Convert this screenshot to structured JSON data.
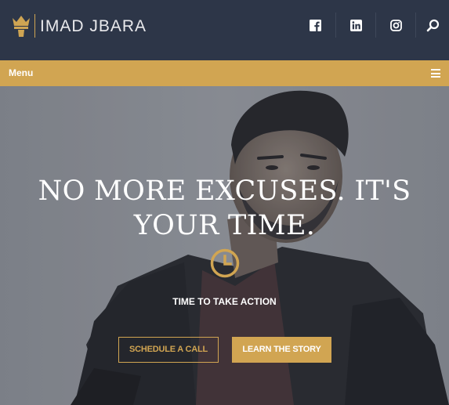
{
  "header": {
    "brand": "IMAD JBARA",
    "social": [
      {
        "name": "facebook",
        "icon": "facebook-icon"
      },
      {
        "name": "linkedin",
        "icon": "linkedin-icon"
      },
      {
        "name": "instagram",
        "icon": "instagram-icon"
      }
    ],
    "search_icon": "search-icon"
  },
  "menu": {
    "label": "Menu",
    "icon": "hamburger-icon"
  },
  "hero": {
    "headline": "NO MORE EXCUSES. IT'S YOUR TIME.",
    "icon": "clock-icon",
    "tagline": "TIME TO TAKE ACTION",
    "buttons": {
      "schedule": "SCHEDULE A CALL",
      "story": "LEARN THE STORY"
    }
  },
  "colors": {
    "header_bg": "#2d3648",
    "accent_gold": "#d1a552",
    "text_white": "#ffffff"
  }
}
